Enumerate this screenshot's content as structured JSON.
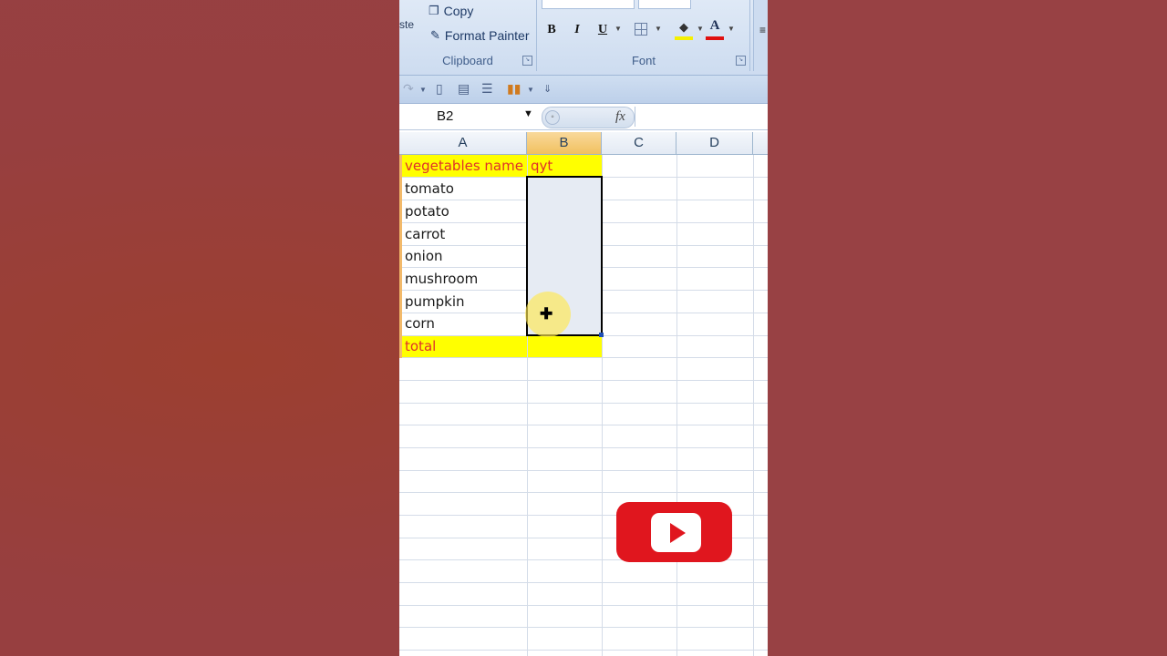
{
  "ribbon": {
    "paste_label": "ste",
    "copy_label": "Copy",
    "format_painter_label": "Format Painter",
    "clipboard_group_label": "Clipboard",
    "font_group_label": "Font",
    "bold": "B",
    "italic": "I",
    "underline": "U",
    "font_color_glyph": "A"
  },
  "formula_bar": {
    "name_box": "B2",
    "fx": "fx",
    "formula": ""
  },
  "columns": [
    "A",
    "B",
    "C",
    "D"
  ],
  "active_column": "B",
  "cells": {
    "A1": "vegetables name",
    "B1": "qyt",
    "A2": "tomato",
    "A3": "potato",
    "A4": "carrot",
    "A5": "onion",
    "A6": "mushroom",
    "A7": "pumpkin",
    "A8": "corn",
    "A9": "total"
  },
  "selection": "B2:B8",
  "colors": {
    "highlight": "#ffff00",
    "header_text": "#e0302a",
    "youtube_red": "#e0161e"
  },
  "icons": [
    "copy-icon",
    "format-painter-icon",
    "fill-color-icon",
    "borders-icon",
    "font-color-icon",
    "youtube-play-icon"
  ]
}
